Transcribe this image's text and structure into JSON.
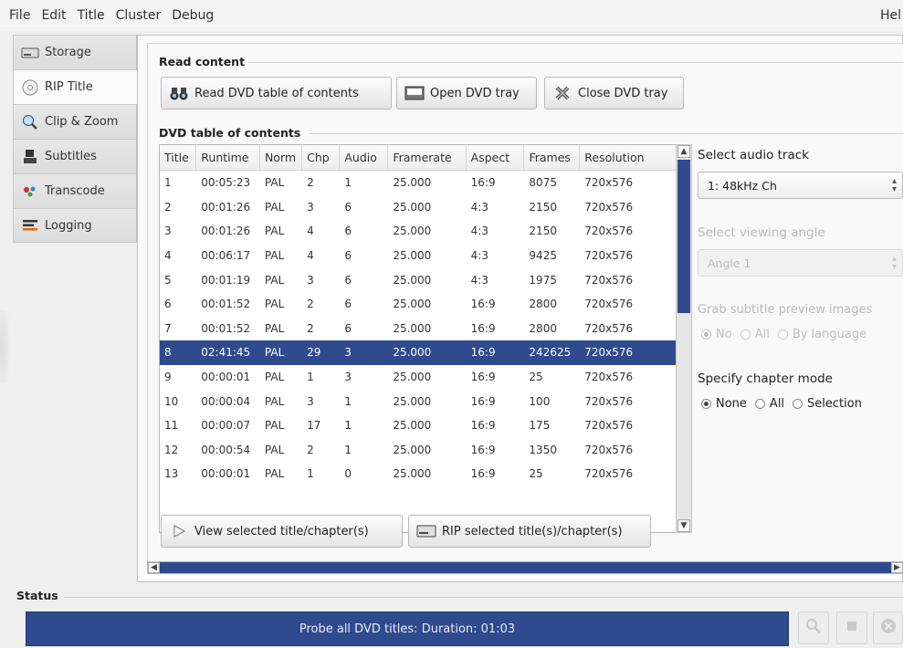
{
  "menu": {
    "items": [
      "File",
      "Edit",
      "Title",
      "Cluster",
      "Debug"
    ],
    "help": "Hel"
  },
  "tabs": [
    {
      "label": "Storage",
      "icon": "drive-icon"
    },
    {
      "label": "RIP Title",
      "icon": "disc-icon"
    },
    {
      "label": "Clip & Zoom",
      "icon": "magnifier-icon"
    },
    {
      "label": "Subtitles",
      "icon": "subtitles-icon"
    },
    {
      "label": "Transcode",
      "icon": "transcode-icon"
    },
    {
      "label": "Logging",
      "icon": "logging-icon"
    }
  ],
  "read_content": {
    "title": "Read content",
    "read_button": "Read DVD table of contents",
    "open_button": "Open DVD tray",
    "close_button": "Close DVD tray"
  },
  "toc": {
    "title": "DVD table of contents",
    "columns": [
      "Title",
      "Runtime",
      "Norm",
      "Chp",
      "Audio",
      "Framerate",
      "Aspect",
      "Frames",
      "Resolution"
    ],
    "rows": [
      [
        "1",
        "00:05:23",
        "PAL",
        "2",
        "1",
        "25.000",
        "16:9",
        "8075",
        "720x576"
      ],
      [
        "2",
        "00:01:26",
        "PAL",
        "3",
        "6",
        "25.000",
        "4:3",
        "2150",
        "720x576"
      ],
      [
        "3",
        "00:01:26",
        "PAL",
        "4",
        "6",
        "25.000",
        "4:3",
        "2150",
        "720x576"
      ],
      [
        "4",
        "00:06:17",
        "PAL",
        "4",
        "6",
        "25.000",
        "4:3",
        "9425",
        "720x576"
      ],
      [
        "5",
        "00:01:19",
        "PAL",
        "3",
        "6",
        "25.000",
        "4:3",
        "1975",
        "720x576"
      ],
      [
        "6",
        "00:01:52",
        "PAL",
        "2",
        "6",
        "25.000",
        "16:9",
        "2800",
        "720x576"
      ],
      [
        "7",
        "00:01:52",
        "PAL",
        "2",
        "6",
        "25.000",
        "16:9",
        "2800",
        "720x576"
      ],
      [
        "8",
        "02:41:45",
        "PAL",
        "29",
        "3",
        "25.000",
        "16:9",
        "242625",
        "720x576"
      ],
      [
        "9",
        "00:00:01",
        "PAL",
        "1",
        "3",
        "25.000",
        "16:9",
        "25",
        "720x576"
      ],
      [
        "10",
        "00:00:04",
        "PAL",
        "3",
        "1",
        "25.000",
        "16:9",
        "100",
        "720x576"
      ],
      [
        "11",
        "00:00:07",
        "PAL",
        "17",
        "1",
        "25.000",
        "16:9",
        "175",
        "720x576"
      ],
      [
        "12",
        "00:00:54",
        "PAL",
        "2",
        "1",
        "25.000",
        "16:9",
        "1350",
        "720x576"
      ],
      [
        "13",
        "00:00:01",
        "PAL",
        "1",
        "0",
        "25.000",
        "16:9",
        "25",
        "720x576"
      ]
    ],
    "selected_title": "8",
    "view_button": "View selected title/chapter(s)",
    "rip_button": "RIP selected title(s)/chapter(s)"
  },
  "audio": {
    "label": "Select audio track",
    "value": "1: 48kHz Ch"
  },
  "angle": {
    "label": "Select viewing angle",
    "value": "Angle 1"
  },
  "subtitle_preview": {
    "label": "Grab subtitle preview images",
    "options": [
      "No",
      "All",
      "By language"
    ],
    "selected": "No"
  },
  "chapter_mode": {
    "label": "Specify chapter mode",
    "options": [
      "None",
      "All",
      "Selection"
    ],
    "selected": "None"
  },
  "status": {
    "title": "Status",
    "text": "Probe all DVD titles: Duration: 01:03"
  },
  "colors": {
    "accent": "#2f4a8d"
  }
}
